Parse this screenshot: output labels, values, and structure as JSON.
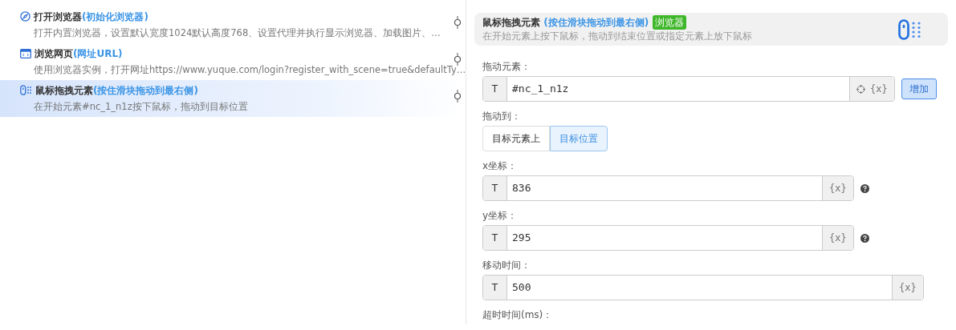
{
  "steps": [
    {
      "title": "打开浏览器",
      "subtitle": "(初始化浏览器)",
      "description": "打开内置浏览器，设置默认宽度1024默认高度768、设置代理并执行显示浏览器、加载图片、…",
      "selected": false
    },
    {
      "title": "浏览网页",
      "subtitle": "(网址URL)",
      "description": "使用浏览器实例，打开网址https://www.yuque.com/login?register_with_scene=true&defaultTy…",
      "selected": false
    },
    {
      "title": "鼠标拖拽元素",
      "subtitle": "(按住滑块拖动到最右侧)",
      "description": "在开始元素#nc_1_n1z按下鼠标，拖动到目标位置",
      "selected": true
    }
  ],
  "detail": {
    "title": "鼠标拖拽元素",
    "subtitle": "(按住滑块拖动到最右侧)",
    "tag": "浏览器",
    "description": "在开始元素上按下鼠标，拖动到结束位置或指定元素上放下鼠标"
  },
  "fields": [
    {
      "kind": "input",
      "label": "拖动元素：",
      "prefix": "T",
      "value": "#nc_1_n1z",
      "picker": true,
      "suffix": "{x}",
      "button": "增加",
      "help": false
    },
    {
      "kind": "toggle",
      "label": "拖动到：",
      "options": [
        {
          "label": "目标元素上",
          "selected": false
        },
        {
          "label": "目标位置",
          "selected": true
        }
      ]
    },
    {
      "kind": "input",
      "label": "x坐标：",
      "prefix": "T",
      "value": "836",
      "picker": false,
      "suffix": "{x}",
      "help": true
    },
    {
      "kind": "input",
      "label": "y坐标：",
      "prefix": "T",
      "value": "295",
      "picker": false,
      "suffix": "{x}",
      "help": true
    },
    {
      "kind": "input",
      "label": "移动时间：",
      "prefix": "T",
      "value": "500",
      "picker": false,
      "suffix": "{x}",
      "help": false
    },
    {
      "kind": "label",
      "label": "超时时间(ms)："
    }
  ]
}
